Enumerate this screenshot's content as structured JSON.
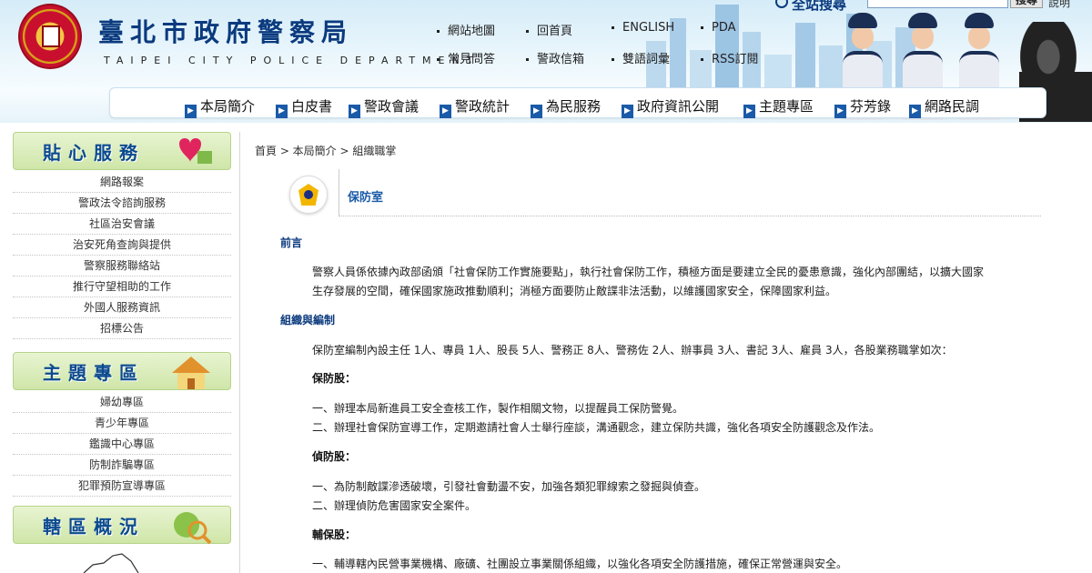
{
  "header": {
    "title": "臺北市政府警察局",
    "subtitle": "TAIPEI CITY POLICE DEPARTMENT",
    "top_links": [
      "網站地圖",
      "回首頁",
      "ENGLISH",
      "PDA",
      "常見問答",
      "警政信箱",
      "雙語詞彙",
      "RSS訂閱"
    ],
    "search_label": "全站搜尋",
    "search_button": "搜尋",
    "search_help": "說明",
    "search_value": ""
  },
  "nav": {
    "items": [
      "本局簡介",
      "白皮書",
      "警政會議",
      "警政統計",
      "為民服務",
      "政府資訊公開",
      "主題專區",
      "芬芳錄",
      "網路民調"
    ]
  },
  "sidebar": {
    "sections": [
      {
        "title": "貼心服務",
        "items": [
          "網路報案",
          "警政法令諮詢服務",
          "社區治安會議",
          "治安死角查詢與提供",
          "警察服務聯絡站",
          "推行守望相助的工作",
          "外國人服務資訊",
          "招標公告"
        ]
      },
      {
        "title": "主題專區",
        "items": [
          "婦幼專區",
          "青少年專區",
          "鑑識中心專區",
          "防制詐騙專區",
          "犯罪預防宣導專區"
        ]
      },
      {
        "title": "轄區概況",
        "items": []
      }
    ]
  },
  "content": {
    "breadcrumb": "首頁 > 本局簡介 > 組織職掌",
    "title": "保防室",
    "heading_intro": "前言",
    "intro_line1": "警察人員係依據內政部函頒「社會保防工作實施要點」，執行社會保防工作，積極方面是要建立全民的憂患意識，強化內部團結，以擴大國家",
    "intro_line2": "生存發展的空間，確保國家施政推動順利；消極方面要防止敵諜非法活動，以維護國家安全，保障國家利益。",
    "heading_org": "組織與編制",
    "org_text": "保防室編制內設主任 1人、專員 1人、股長 5人、警務正 8人、警務佐 2人、辦事員 3人、書記 3人、雇員 3人，各股業務職掌如次：",
    "sections": [
      {
        "name": "保防股：",
        "lines": [
          "一、辦理本局新進員工安全查核工作，製作相關文物，以提醒員工保防警覺。",
          "二、辦理社會保防宣導工作，定期邀請社會人士舉行座談，溝通觀念，建立保防共識，強化各項安全防護觀念及作法。"
        ]
      },
      {
        "name": "偵防股：",
        "lines": [
          "一、為防制敵諜滲透破壞，引發社會動盪不安，加強各類犯罪線索之發掘與偵查。",
          "二、辦理偵防危害國家安全案件。"
        ]
      },
      {
        "name": "輔保股：",
        "lines": [
          "一、輔導轄內民營事業機構、廠礦、社團設立事業關係組織，以強化各項安全防護措施，確保正常營運與安全。"
        ]
      }
    ]
  },
  "colors": {
    "title_blue": "#0b3a7e",
    "link_blue": "#1a5aa8",
    "sidebar_green": "#cfe6a8",
    "logo_red": "#c8102e"
  }
}
